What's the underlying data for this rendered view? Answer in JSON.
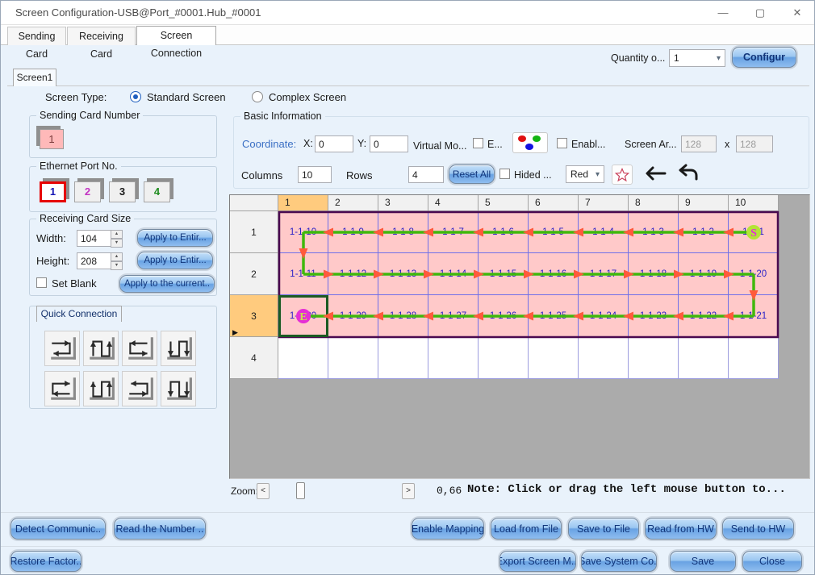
{
  "window": {
    "title": "Screen Configuration-USB@Port_#0001.Hub_#0001",
    "minimize": "—",
    "maximize": "▢",
    "close": "✕"
  },
  "tabs": {
    "sending": "Sending Card",
    "receiving": "Receiving Card",
    "connection": "Screen Connection"
  },
  "toolbar": {
    "quantity_label": "Quantity o...",
    "quantity_value": "1",
    "configure_label": "Configur"
  },
  "screen_tab": {
    "label": "Screen1"
  },
  "screen_type": {
    "label": "Screen Type:",
    "standard": "Standard Screen",
    "complex": "Complex Screen"
  },
  "sending_card": {
    "title": "Sending Card Number",
    "card_number": "1"
  },
  "ethernet": {
    "title": "Ethernet Port No.",
    "ports": [
      {
        "label": "1",
        "color": "#1414B4",
        "selected": true
      },
      {
        "label": "2",
        "color": "#C233C2",
        "selected": false
      },
      {
        "label": "3",
        "color": "#1A1A1A",
        "selected": false
      },
      {
        "label": "4",
        "color": "#1E8C1E",
        "selected": false
      }
    ]
  },
  "receiving_card": {
    "title": "Receiving Card Size",
    "width_label": "Width:",
    "width_value": "104",
    "height_label": "Height:",
    "height_value": "208",
    "apply_width": "Apply to Entir...",
    "apply_height": "Apply to Entir...",
    "set_blank": "Set Blank",
    "apply_current": "Apply to the current.."
  },
  "quick_connection": {
    "title": "Quick Connection"
  },
  "basic_info": {
    "title": "Basic Information",
    "coordinate_label": "Coordinate:",
    "x_label": "X:",
    "x_value": "0",
    "y_label": "Y:",
    "y_value": "0",
    "virtual_mode_label": "Virtual Mo...",
    "enable_virtual_label": "E...",
    "enable_label": "Enabl...",
    "screen_area_label": "Screen Ar...",
    "area_width": "128",
    "area_times": "x",
    "area_height": "128",
    "columns_label": "Columns",
    "columns_value": "10",
    "rows_label": "Rows",
    "rows_value": "4",
    "reset_all": "Reset All",
    "hided_label": "Hided ...",
    "line_color_value": "Red"
  },
  "grid": {
    "col_headers": [
      "1",
      "2",
      "3",
      "4",
      "5",
      "6",
      "7",
      "8",
      "9",
      "10"
    ],
    "row_headers": [
      "1",
      "2",
      "3",
      "4"
    ],
    "highlight_col_index": 0,
    "highlight_row_index": 2,
    "cells": [
      [
        "1-1-10",
        "1-1-9",
        "1-1-8",
        "1-1-7",
        "1-1-6",
        "1-1-5",
        "1-1-4",
        "1-1-3",
        "1-1-2",
        "1-1-1"
      ],
      [
        "1-1-11",
        "1-1-12",
        "1-1-13",
        "1-1-14",
        "1-1-15",
        "1-1-16",
        "1-1-17",
        "1-1-18",
        "1-1-19",
        "1-1-20"
      ],
      [
        "1-1-30",
        "1-1-29",
        "1-1-28",
        "1-1-27",
        "1-1-26",
        "1-1-25",
        "1-1-24",
        "1-1-23",
        "1-1-22",
        "1-1-21"
      ],
      [
        "",
        "",
        "",
        "",
        "",
        "",
        "",
        "",
        "",
        ""
      ]
    ],
    "start_marker": "S",
    "end_marker": "E",
    "selected_cell": {
      "row": 2,
      "col": 0
    },
    "colors": {
      "cell_bg": "#FFC9C9",
      "cell_border": "#7070E8",
      "region_outline": "#4A0A50",
      "line": "#3FB80C",
      "arrow": "#FF5A3C",
      "start_fill": "#B4E436",
      "start_text": "#E station#E52ED6",
      "start_letter": "#E52ED6",
      "end_fill": "#E52ED6",
      "end_letter": "#C8E04A",
      "selected_border": "#1A5A22"
    }
  },
  "zoom_bar": {
    "label": "Zoom:",
    "dec": "<",
    "inc": ">",
    "value": "0,66",
    "note": "Note: Click or drag the left mouse button to..."
  },
  "actions_row1": [
    "Detect Communic..",
    "Read the Number ..",
    "Enable Mapping",
    "Load from File",
    "Save to File",
    "Read from HW",
    "Send to HW"
  ],
  "actions_row2": [
    "Restore Factor..",
    "Export Screen M...",
    "Save System Co..",
    "Save",
    "Close"
  ]
}
